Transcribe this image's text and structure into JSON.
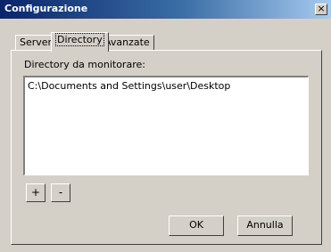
{
  "window": {
    "title": "Configurazione",
    "close_label": "×"
  },
  "tabs": [
    {
      "label": "Server",
      "active": false
    },
    {
      "label": "Directory",
      "active": true
    },
    {
      "label": "Avanzate",
      "active": false
    }
  ],
  "directory_panel": {
    "label": "Directory da monitorare:",
    "items": [
      "C:\\Documents and Settings\\user\\Desktop"
    ],
    "add_label": "+",
    "remove_label": "-"
  },
  "footer": {
    "ok_label": "OK",
    "cancel_label": "Annulla"
  }
}
